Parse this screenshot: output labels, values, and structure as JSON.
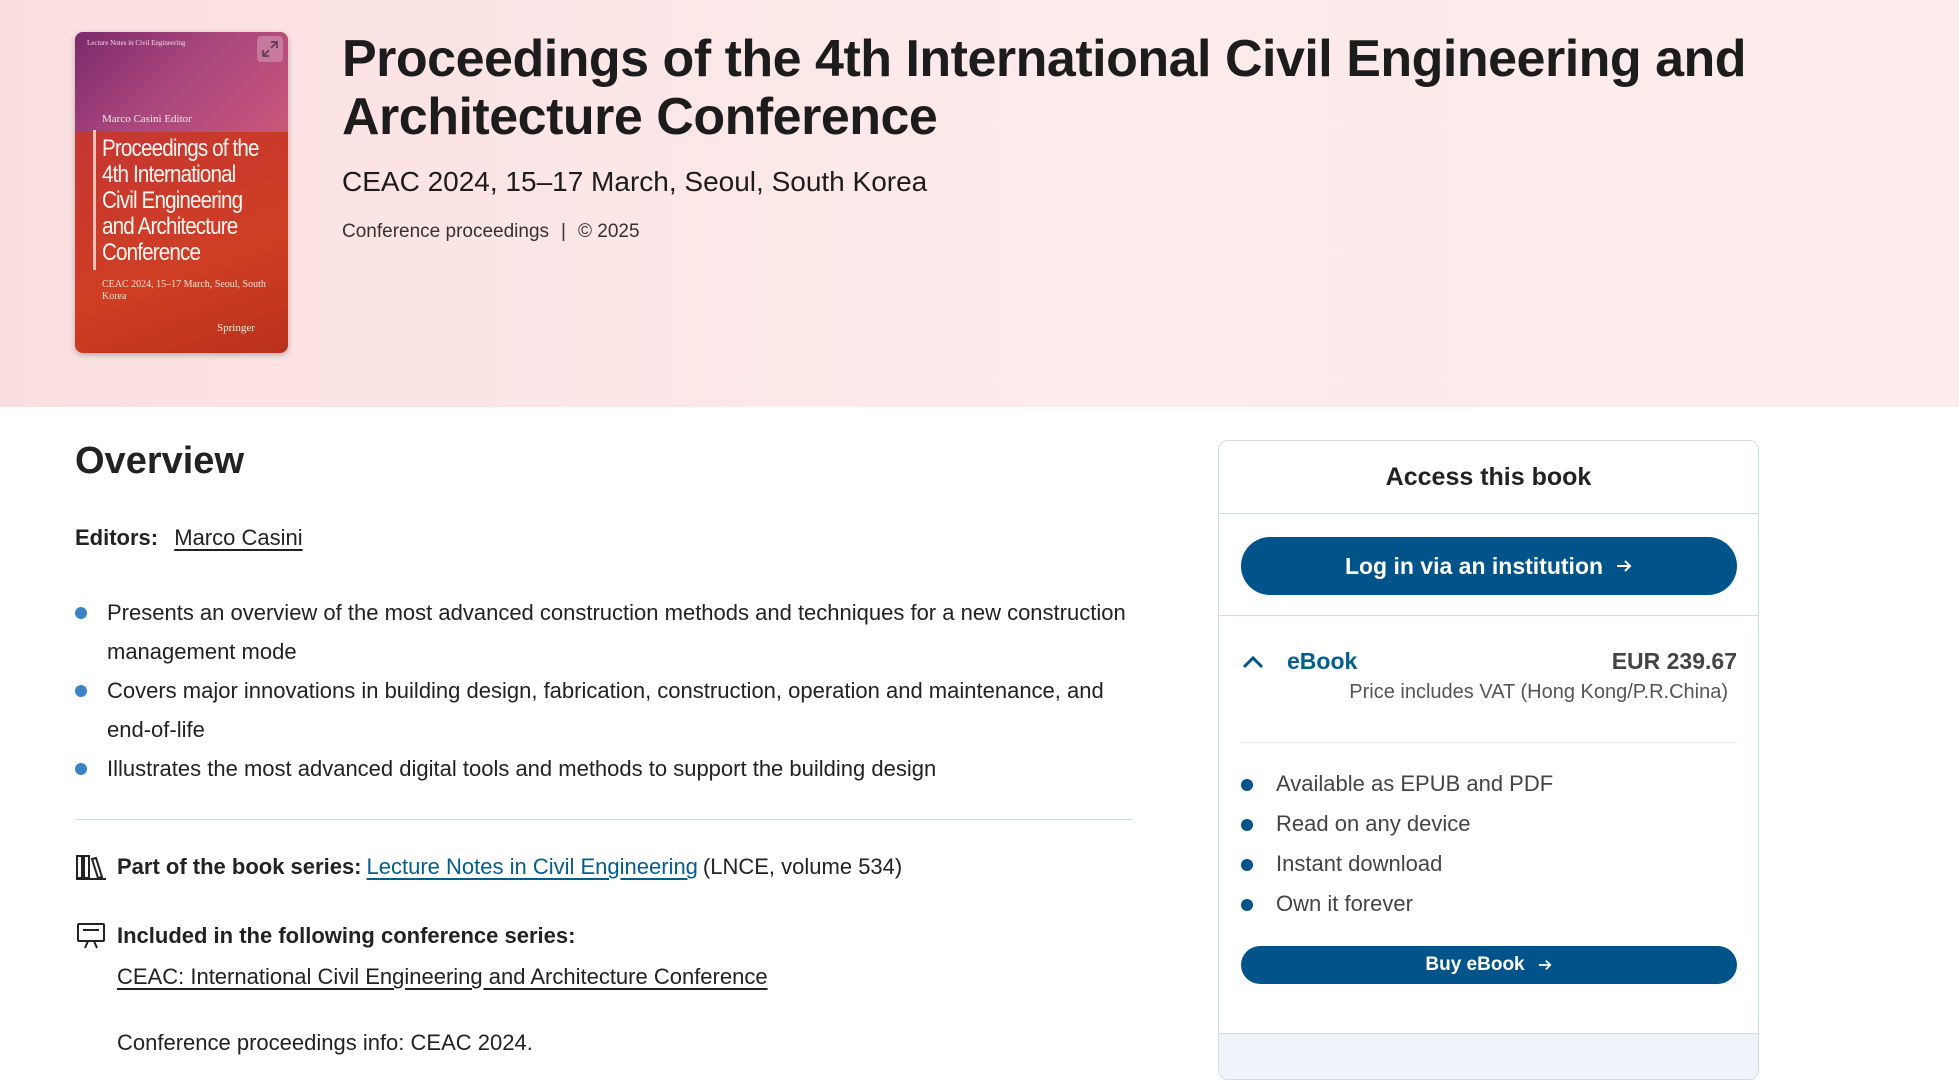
{
  "book": {
    "title": "Proceedings of the 4th International Civil Engineering and Architecture Conference",
    "subtitle": "CEAC 2024, 15–17 March, Seoul, South Korea",
    "type": "Conference proceedings",
    "separator": "|",
    "copyright": "© 2025"
  },
  "cover": {
    "series": "Lecture Notes in Civil Engineering",
    "editor": "Marco Casini  Editor",
    "title": "Proceedings of the 4th International Civil Engineering and Architecture Conference",
    "subtitle": "CEAC 2024, 15–17 March, Seoul, South Korea",
    "publisher": "Springer"
  },
  "overview": {
    "heading": "Overview",
    "editors_label": "Editors:",
    "editor_name": "Marco Casini",
    "bullets": [
      "Presents an overview of the most advanced construction methods and techniques for a new construction management mode",
      "Covers major innovations in building design, fabrication, construction, operation and maintenance, and end-of-life",
      "Illustrates the most advanced digital tools and methods to support the building design"
    ],
    "series_label": "Part of the book series:",
    "series_link": "Lecture Notes in Civil Engineering",
    "series_suffix": "(LNCE, volume 534)",
    "conference_label": "Included in the following conference series:",
    "conference_link": "CEAC: International Civil Engineering and Architecture Conference",
    "conference_info": "Conference proceedings info: CEAC 2024."
  },
  "access": {
    "heading": "Access this book",
    "login_button": "Log in via an institution",
    "ebook_label": "eBook",
    "price": "EUR 239.67",
    "vat_note": "Price includes VAT (Hong Kong/P.R.China)",
    "features": [
      "Available as EPUB and PDF",
      "Read on any device",
      "Instant download",
      "Own it forever"
    ],
    "buy_button": "Buy eBook"
  },
  "colors": {
    "accent": "#01548a",
    "link": "#025e8d",
    "bullet": "#3a83c5",
    "hero_bg": "#fde9e9"
  }
}
